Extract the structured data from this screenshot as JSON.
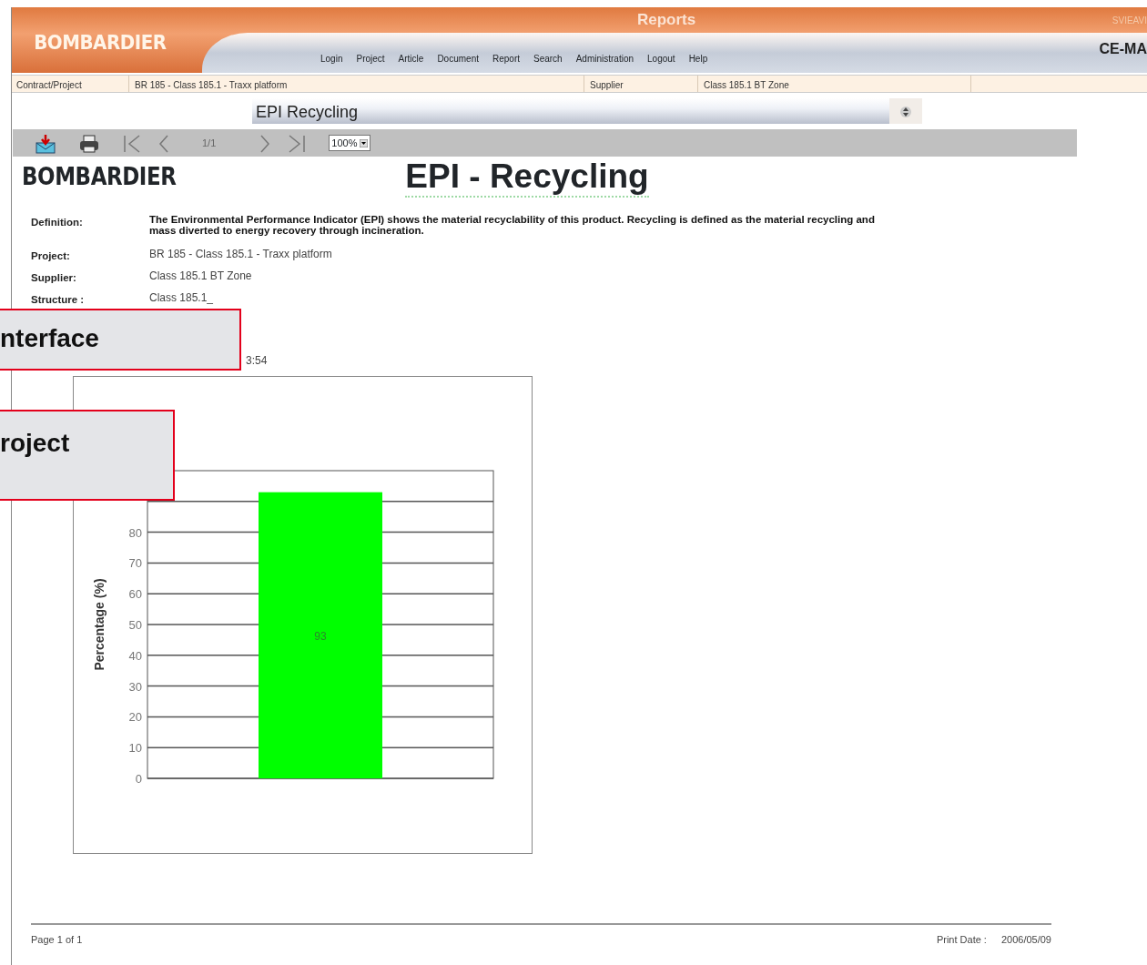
{
  "header": {
    "logo": "BOMBARDIER",
    "title": "Reports",
    "user": "SVIEAVI",
    "app_name": "CE-MA",
    "menu": [
      "Login",
      "Project",
      "Article",
      "Document",
      "Report",
      "Search",
      "Administration",
      "Logout",
      "Help"
    ]
  },
  "info_bar": [
    {
      "label": "Contract/Project",
      "value": "BR 185 - Class 185.1 - Traxx platform"
    },
    {
      "label": "Supplier",
      "value": "Class 185.1 BT Zone"
    }
  ],
  "report_select": {
    "value": "EPI Recycling"
  },
  "toolbar": {
    "page": "1/1",
    "zoom": "100%"
  },
  "report": {
    "logo": "BOMBARDIER",
    "title": "EPI - Recycling",
    "fields": [
      {
        "label": "Definition:",
        "value": "The Environmental Performance Indicator (EPI) shows the material recyclability of this product. Recycling is defined as the material recycling and mass diverted to energy recovery through incineration.",
        "bold": true
      },
      {
        "label": "Project:",
        "value": "BR 185 - Class 185.1 - Traxx platform",
        "bold": false
      },
      {
        "label": "Supplier:",
        "value": "Class 185.1 BT Zone",
        "bold": false
      },
      {
        "label": "Structure :",
        "value": "Class 185.1_",
        "bold": false
      }
    ],
    "partial_line": "3:54",
    "chart_data": {
      "type": "bar",
      "ylabel": "Percentage (%)",
      "categories": [
        null
      ],
      "ylim": [
        0,
        100
      ],
      "yticks": [
        0,
        10,
        20,
        30,
        40,
        50,
        60,
        70,
        80
      ],
      "grid": true,
      "data_labels": true,
      "series": [
        {
          "color": "#00ff00",
          "values": [
            93
          ]
        }
      ]
    },
    "footer": {
      "page": "Page 1 of 1",
      "print_date_label": "Print Date :",
      "print_date": "2006/05/09"
    }
  },
  "callouts": [
    "nterface",
    "roject"
  ]
}
